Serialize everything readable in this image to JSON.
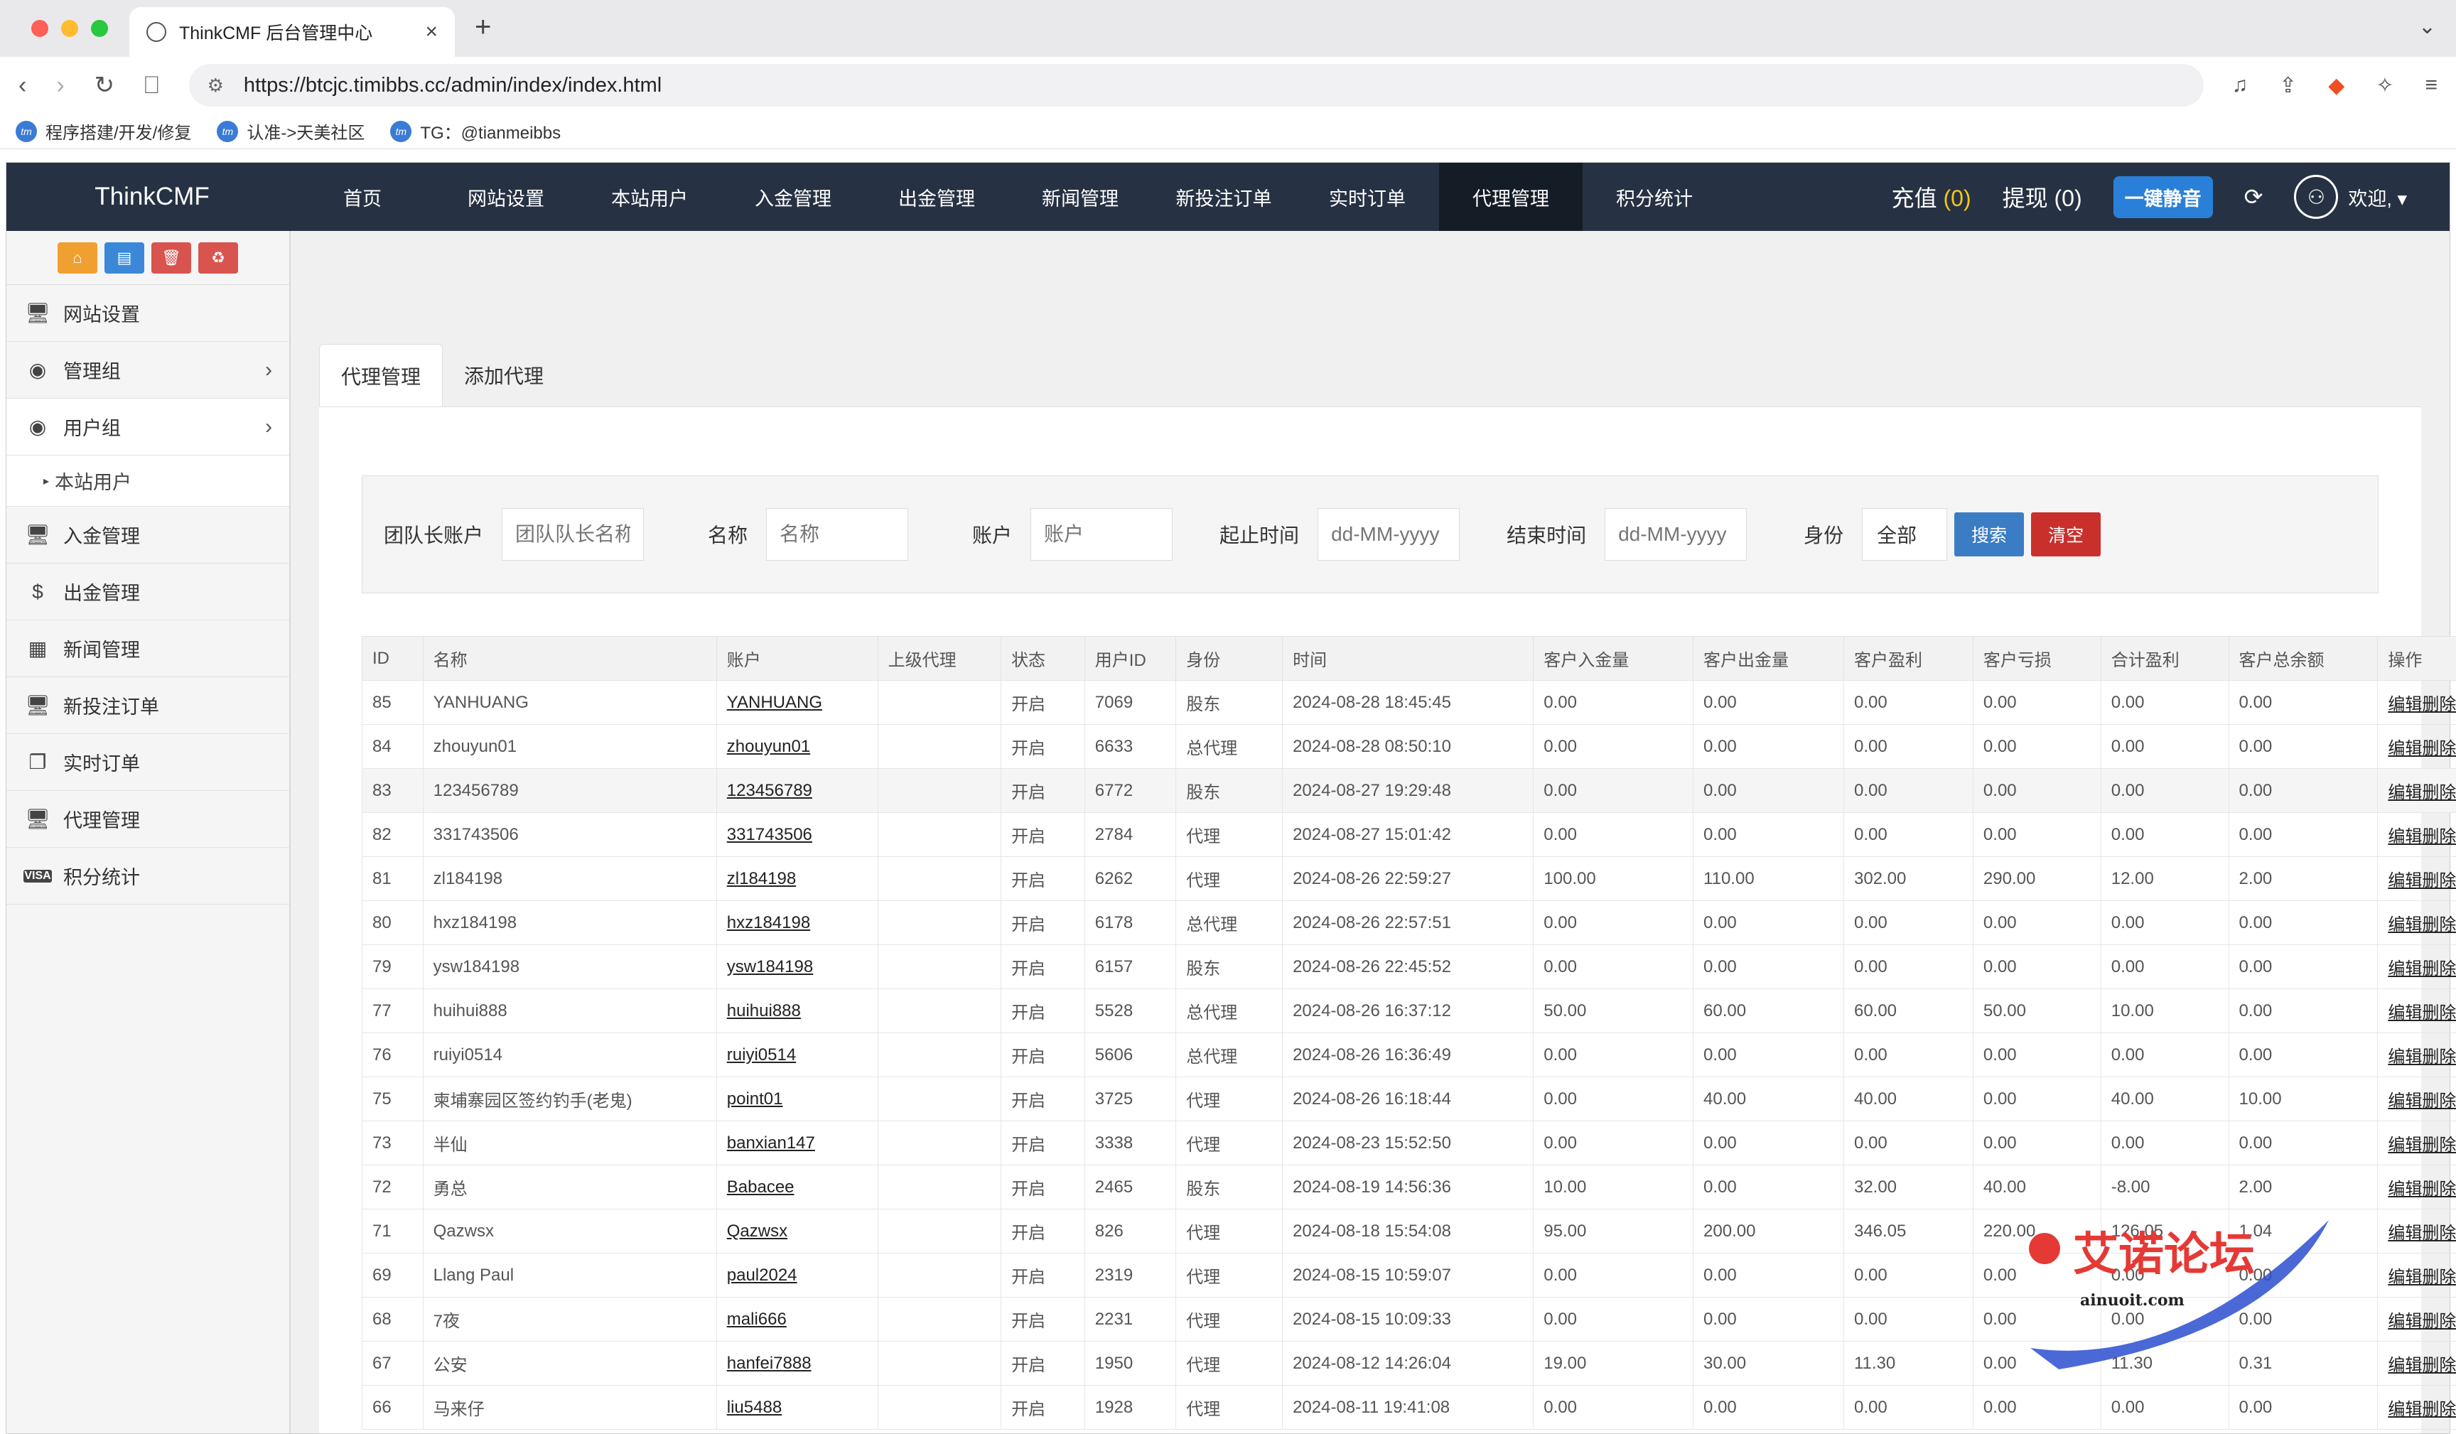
{
  "browser": {
    "tab_title": "ThinkCMF 后台管理中心",
    "url": "https://btcjc.timibbs.cc/admin/index/index.html",
    "bookmarks": [
      "程序搭建/开发/修复",
      "认准->天美社区",
      "TG：@tianmeibbs"
    ]
  },
  "header": {
    "brand": "ThinkCMF",
    "nav": [
      "首页",
      "网站设置",
      "本站用户",
      "入金管理",
      "出金管理",
      "新闻管理",
      "新投注订单",
      "实时订单",
      "代理管理",
      "积分统计"
    ],
    "recharge_label": "充值",
    "recharge_count": "(0)",
    "withdraw_label": "提现",
    "withdraw_count": "(0)",
    "mute_label": "一键静音",
    "welcome": "欢迎,"
  },
  "sidebar": {
    "items": [
      "网站设置",
      "管理组",
      "用户组",
      "入金管理",
      "出金管理",
      "新闻管理",
      "新投注订单",
      "实时订单",
      "代理管理",
      "积分统计"
    ],
    "sub_item": "本站用户"
  },
  "tabs": [
    "代理管理",
    "添加代理"
  ],
  "filters": {
    "team_label": "团队长账户",
    "team_placeholder": "团队队长名称",
    "name_label": "名称",
    "name_placeholder": "名称",
    "account_label": "账户",
    "account_placeholder": "账户",
    "start_label": "起止时间",
    "start_placeholder": "dd-MM-yyyy",
    "end_label": "结束时间",
    "end_placeholder": "dd-MM-yyyy",
    "role_label": "身份",
    "role_value": "全部",
    "search_btn": "搜索",
    "clear_btn": "清空"
  },
  "table": {
    "headers": [
      "ID",
      "名称",
      "账户",
      "上级代理",
      "状态",
      "用户ID",
      "身份",
      "时间",
      "客户入金量",
      "客户出金量",
      "客户盈利",
      "客户亏损",
      "合计盈利",
      "客户总余额",
      "操作"
    ],
    "edit": "编辑",
    "delete": "删除",
    "rows": [
      [
        "85",
        "YANHUANG",
        "YANHUANG",
        "",
        "开启",
        "7069",
        "股东",
        "2024-08-28 18:45:45",
        "0.00",
        "0.00",
        "0.00",
        "0.00",
        "0.00",
        "0.00"
      ],
      [
        "84",
        "zhouyun01",
        "zhouyun01",
        "",
        "开启",
        "6633",
        "总代理",
        "2024-08-28 08:50:10",
        "0.00",
        "0.00",
        "0.00",
        "0.00",
        "0.00",
        "0.00"
      ],
      [
        "83",
        "123456789",
        "123456789",
        "",
        "开启",
        "6772",
        "股东",
        "2024-08-27 19:29:48",
        "0.00",
        "0.00",
        "0.00",
        "0.00",
        "0.00",
        "0.00"
      ],
      [
        "82",
        "331743506",
        "331743506",
        "",
        "开启",
        "2784",
        "代理",
        "2024-08-27 15:01:42",
        "0.00",
        "0.00",
        "0.00",
        "0.00",
        "0.00",
        "0.00"
      ],
      [
        "81",
        "zl184198",
        "zl184198",
        "",
        "开启",
        "6262",
        "代理",
        "2024-08-26 22:59:27",
        "100.00",
        "110.00",
        "302.00",
        "290.00",
        "12.00",
        "2.00"
      ],
      [
        "80",
        "hxz184198",
        "hxz184198",
        "",
        "开启",
        "6178",
        "总代理",
        "2024-08-26 22:57:51",
        "0.00",
        "0.00",
        "0.00",
        "0.00",
        "0.00",
        "0.00"
      ],
      [
        "79",
        "ysw184198",
        "ysw184198",
        "",
        "开启",
        "6157",
        "股东",
        "2024-08-26 22:45:52",
        "0.00",
        "0.00",
        "0.00",
        "0.00",
        "0.00",
        "0.00"
      ],
      [
        "77",
        "huihui888",
        "huihui888",
        "",
        "开启",
        "5528",
        "总代理",
        "2024-08-26 16:37:12",
        "50.00",
        "60.00",
        "60.00",
        "50.00",
        "10.00",
        "0.00"
      ],
      [
        "76",
        "ruiyi0514",
        "ruiyi0514",
        "",
        "开启",
        "5606",
        "总代理",
        "2024-08-26 16:36:49",
        "0.00",
        "0.00",
        "0.00",
        "0.00",
        "0.00",
        "0.00"
      ],
      [
        "75",
        "柬埔寨园区签约钓手(老鬼)",
        "point01",
        "",
        "开启",
        "3725",
        "代理",
        "2024-08-26 16:18:44",
        "0.00",
        "40.00",
        "40.00",
        "0.00",
        "40.00",
        "10.00"
      ],
      [
        "73",
        "半仙",
        "banxian147",
        "",
        "开启",
        "3338",
        "代理",
        "2024-08-23 15:52:50",
        "0.00",
        "0.00",
        "0.00",
        "0.00",
        "0.00",
        "0.00"
      ],
      [
        "72",
        "勇总",
        "Babacee",
        "",
        "开启",
        "2465",
        "股东",
        "2024-08-19 14:56:36",
        "10.00",
        "0.00",
        "32.00",
        "40.00",
        "-8.00",
        "2.00"
      ],
      [
        "71",
        "Qazwsx",
        "Qazwsx",
        "",
        "开启",
        "826",
        "代理",
        "2024-08-18 15:54:08",
        "95.00",
        "200.00",
        "346.05",
        "220.00",
        "126.05",
        "1.04"
      ],
      [
        "69",
        "Llang Paul",
        "paul2024",
        "",
        "开启",
        "2319",
        "代理",
        "2024-08-15 10:59:07",
        "0.00",
        "0.00",
        "0.00",
        "0.00",
        "0.00",
        "0.00"
      ],
      [
        "68",
        "7夜",
        "mali666",
        "",
        "开启",
        "2231",
        "代理",
        "2024-08-15 10:09:33",
        "0.00",
        "0.00",
        "0.00",
        "0.00",
        "0.00",
        "0.00"
      ],
      [
        "67",
        "公安",
        "hanfei7888",
        "",
        "开启",
        "1950",
        "代理",
        "2024-08-12 14:26:04",
        "19.00",
        "30.00",
        "11.30",
        "0.00",
        "11.30",
        "0.31"
      ],
      [
        "66",
        "马来仔",
        "liu5488",
        "",
        "开启",
        "1928",
        "代理",
        "2024-08-11 19:41:08",
        "0.00",
        "0.00",
        "0.00",
        "0.00",
        "0.00",
        "0.00"
      ]
    ]
  },
  "watermark": {
    "title": "艾诺论坛",
    "sub": "ainuoit.com"
  },
  "colors": {
    "nav_bg": "#263243",
    "nav_active": "#141c26",
    "accent_blue": "#2a80d8",
    "count_yellow": "#f5c518",
    "danger": "#c9302c"
  }
}
